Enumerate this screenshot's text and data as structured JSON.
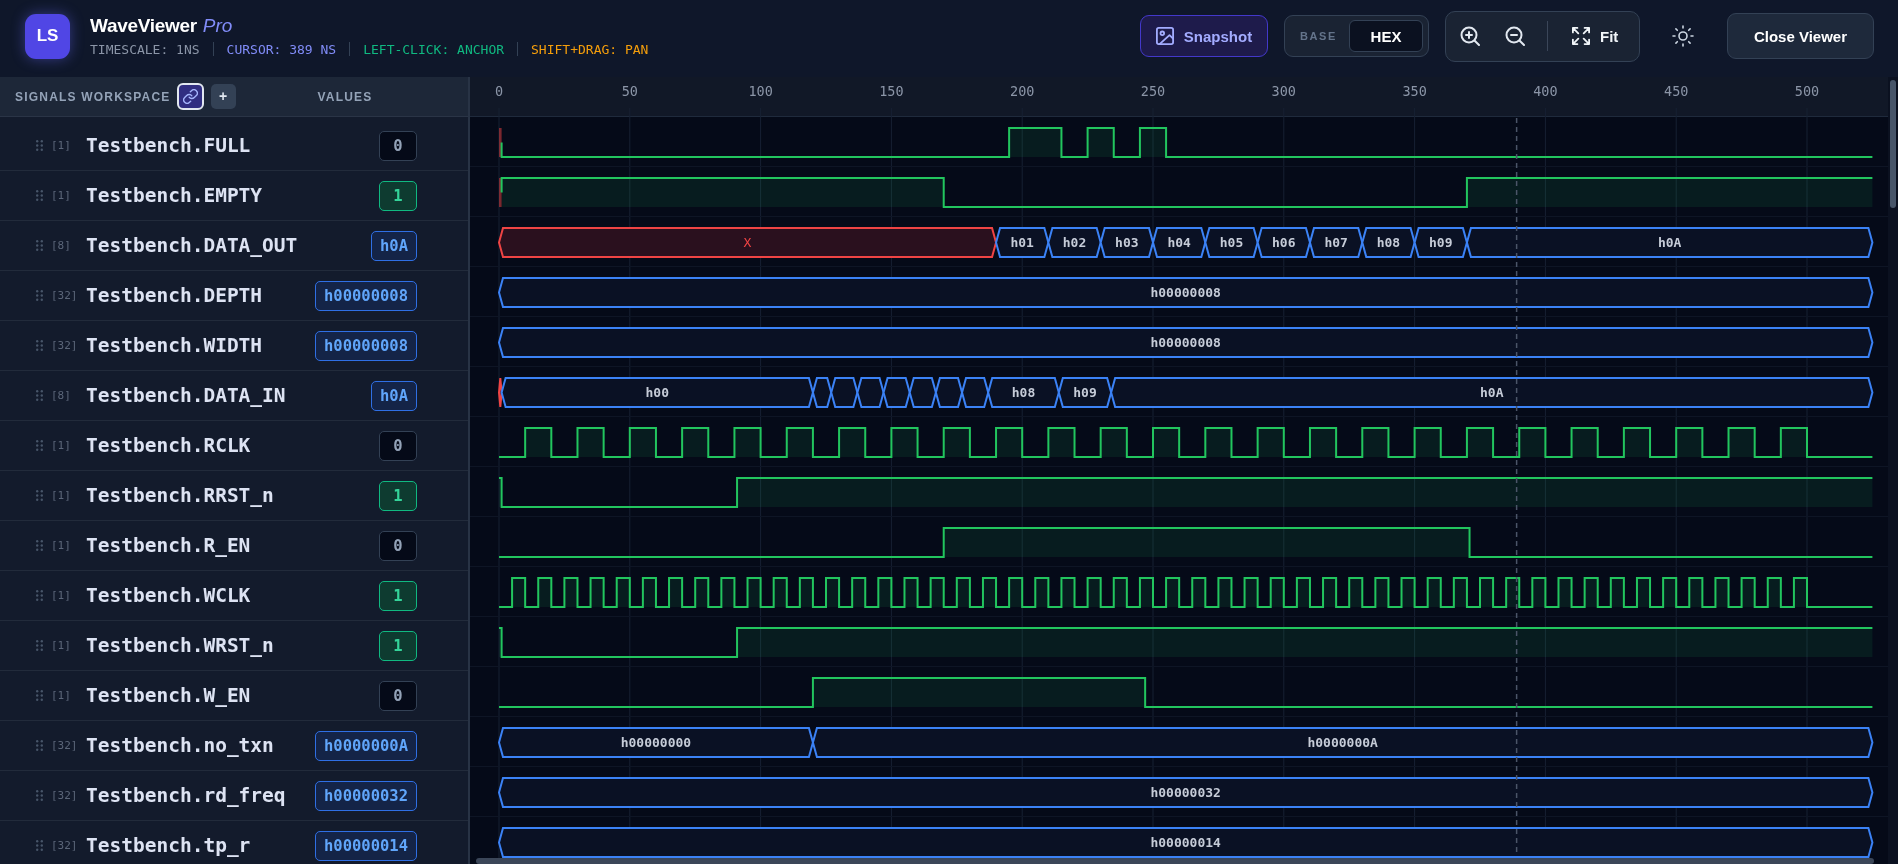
{
  "header": {
    "logo": "LS",
    "title": "WaveViewer",
    "edition": "Pro",
    "hints": [
      {
        "text": "TIMESCALE: 1NS",
        "color": "#8b95a7"
      },
      {
        "text": "CURSOR: 389 NS",
        "color": "#818cf8"
      },
      {
        "text": "LEFT-CLICK: ANCHOR",
        "color": "#10b981"
      },
      {
        "text": "SHIFT+DRAG: PAN",
        "color": "#f59e0b"
      }
    ]
  },
  "toolbar": {
    "snapshot": "Snapshot",
    "base": {
      "label": "BASE",
      "value": "HEX"
    },
    "fit": "Fit",
    "close": "Close Viewer"
  },
  "signals_panel": {
    "title": "SIGNALS WORKSPACE",
    "link_toggle": {
      "on": true
    },
    "add": "+",
    "values_heading": "VALUES"
  },
  "signals": [
    {
      "width": "[1]",
      "name": "Testbench.FULL",
      "kind": "bit",
      "value": "0",
      "high": false
    },
    {
      "width": "[1]",
      "name": "Testbench.EMPTY",
      "kind": "bit",
      "value": "1",
      "high": true
    },
    {
      "width": "[8]",
      "name": "Testbench.DATA_OUT",
      "kind": "bus",
      "value": "h0A",
      "trace": [
        {
          "kind": "unknown",
          "label": "X"
        },
        {
          "kind": "value",
          "label": "h01"
        },
        {
          "kind": "value",
          "label": "h02"
        },
        {
          "kind": "value",
          "label": "h03"
        },
        {
          "kind": "value",
          "label": "h04"
        },
        {
          "kind": "value",
          "label": "h05"
        },
        {
          "kind": "value",
          "label": "h06"
        },
        {
          "kind": "value",
          "label": "h07"
        },
        {
          "kind": "value",
          "label": "h08"
        },
        {
          "kind": "value",
          "label": "h09"
        },
        {
          "kind": "value",
          "label": "h0A"
        }
      ]
    },
    {
      "width": "[32]",
      "name": "Testbench.DEPTH",
      "kind": "bus",
      "value": "h00000008",
      "trace": [
        {
          "kind": "value",
          "label": "h00000008"
        }
      ]
    },
    {
      "width": "[32]",
      "name": "Testbench.WIDTH",
      "kind": "bus",
      "value": "h00000008",
      "trace": [
        {
          "kind": "value",
          "label": "h00000008"
        }
      ]
    },
    {
      "width": "[8]",
      "name": "Testbench.DATA_IN",
      "kind": "bus",
      "value": "h0A",
      "trace": [
        {
          "kind": "unknown"
        },
        {
          "kind": "value",
          "label": "h00"
        },
        {
          "kind": "value"
        },
        {
          "kind": "value"
        },
        {
          "kind": "value"
        },
        {
          "kind": "value"
        },
        {
          "kind": "value"
        },
        {
          "kind": "value"
        },
        {
          "kind": "value"
        },
        {
          "kind": "value",
          "label": "h08"
        },
        {
          "kind": "value",
          "label": "h09"
        },
        {
          "kind": "value",
          "label": "h0A"
        }
      ]
    },
    {
      "width": "[1]",
      "name": "Testbench.RCLK",
      "kind": "bit",
      "value": "0",
      "high": false
    },
    {
      "width": "[1]",
      "name": "Testbench.RRST_n",
      "kind": "bit",
      "value": "1",
      "high": true
    },
    {
      "width": "[1]",
      "name": "Testbench.R_EN",
      "kind": "bit",
      "value": "0",
      "high": false
    },
    {
      "width": "[1]",
      "name": "Testbench.WCLK",
      "kind": "bit",
      "value": "1",
      "high": true
    },
    {
      "width": "[1]",
      "name": "Testbench.WRST_n",
      "kind": "bit",
      "value": "1",
      "high": true
    },
    {
      "width": "[1]",
      "name": "Testbench.W_EN",
      "kind": "bit",
      "value": "0",
      "high": false
    },
    {
      "width": "[32]",
      "name": "Testbench.no_txn",
      "kind": "bus",
      "value": "h0000000A",
      "trace": [
        {
          "kind": "value",
          "label": "h00000000"
        },
        {
          "kind": "value",
          "label": "h0000000A"
        }
      ]
    },
    {
      "width": "[32]",
      "name": "Testbench.rd_freq",
      "kind": "bus",
      "value": "h00000032",
      "trace": [
        {
          "kind": "value",
          "label": "h00000032"
        }
      ]
    },
    {
      "width": "[32]",
      "name": "Testbench.tp_r",
      "kind": "bus",
      "value": "h00000014",
      "trace": [
        {
          "kind": "value",
          "label": "h00000014"
        }
      ]
    }
  ],
  "waveform": {
    "ruler": [
      "0",
      "50",
      "100",
      "150",
      "200",
      "250",
      "300",
      "350",
      "400",
      "450",
      "500"
    ]
  }
}
